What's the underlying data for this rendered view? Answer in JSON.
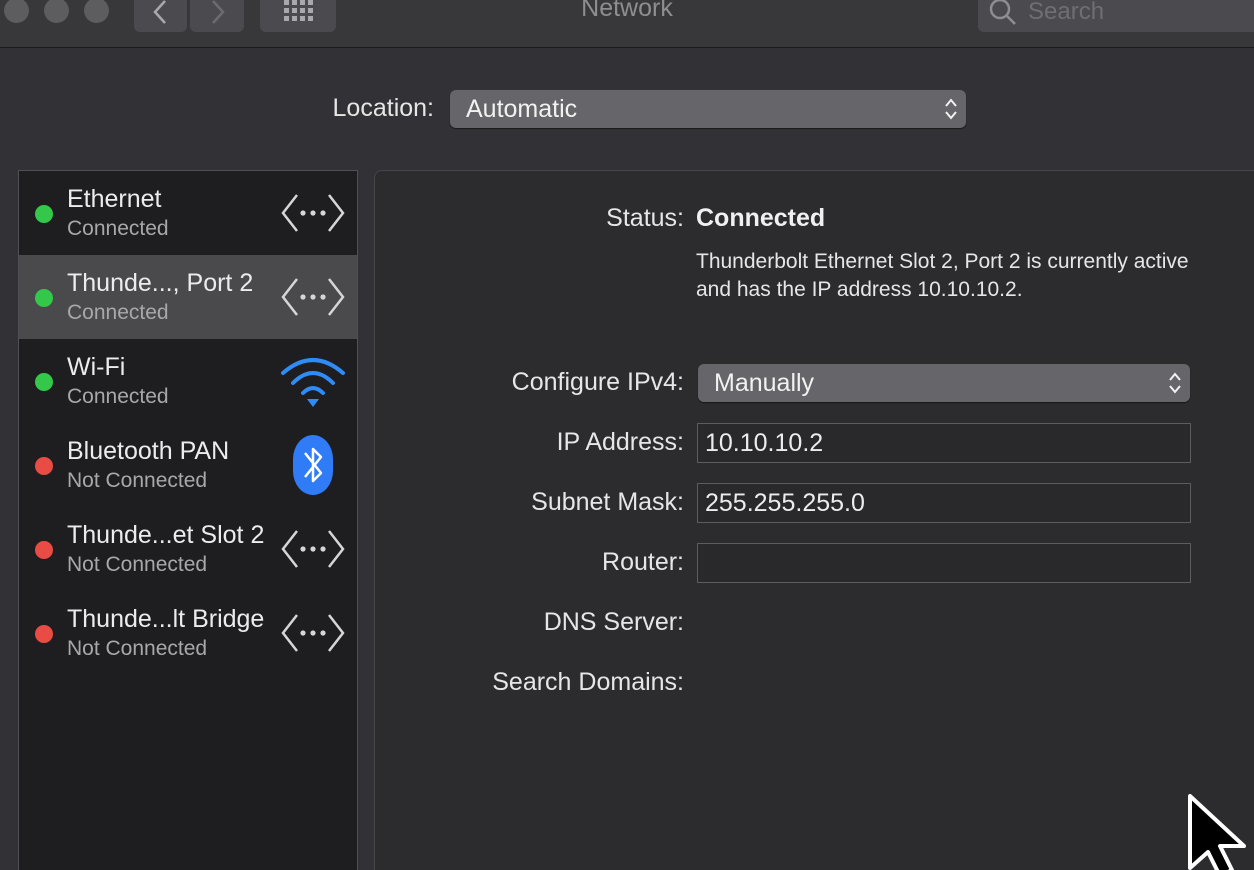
{
  "window": {
    "title": "Network",
    "search_placeholder": "Search"
  },
  "location": {
    "label": "Location:",
    "value": "Automatic"
  },
  "services": [
    {
      "name": "Ethernet",
      "status": "Connected",
      "status_color": "#34c84a",
      "icon": "ethernet-icon"
    },
    {
      "name": "Thunde..., Port 2",
      "status": "Connected",
      "status_color": "#34c84a",
      "icon": "ethernet-icon",
      "selected": true
    },
    {
      "name": "Wi-Fi",
      "status": "Connected",
      "status_color": "#34c84a",
      "icon": "wifi-icon"
    },
    {
      "name": "Bluetooth PAN",
      "status": "Not Connected",
      "status_color": "#e94b45",
      "icon": "bluetooth-icon"
    },
    {
      "name": "Thunde...et Slot 2",
      "status": "Not Connected",
      "status_color": "#e94b45",
      "icon": "ethernet-icon"
    },
    {
      "name": "Thunde...lt Bridge",
      "status": "Not Connected",
      "status_color": "#e94b45",
      "icon": "ethernet-icon"
    }
  ],
  "detail": {
    "status_label": "Status:",
    "status_value": "Connected",
    "status_description": "Thunderbolt Ethernet Slot 2, Port 2 is currently active and has the IP address 10.10.10.2.",
    "configure_label": "Configure IPv4:",
    "configure_value": "Manually",
    "ip_label": "IP Address:",
    "ip_value": "10.10.10.2",
    "subnet_label": "Subnet Mask:",
    "subnet_value": "255.255.255.0",
    "router_label": "Router:",
    "router_value": "",
    "dns_label": "DNS Server:",
    "search_domains_label": "Search Domains:"
  },
  "colors": {
    "accent_blue": "#2f7cf6",
    "connected_green": "#34c84a",
    "disconnected_red": "#e94b45"
  }
}
